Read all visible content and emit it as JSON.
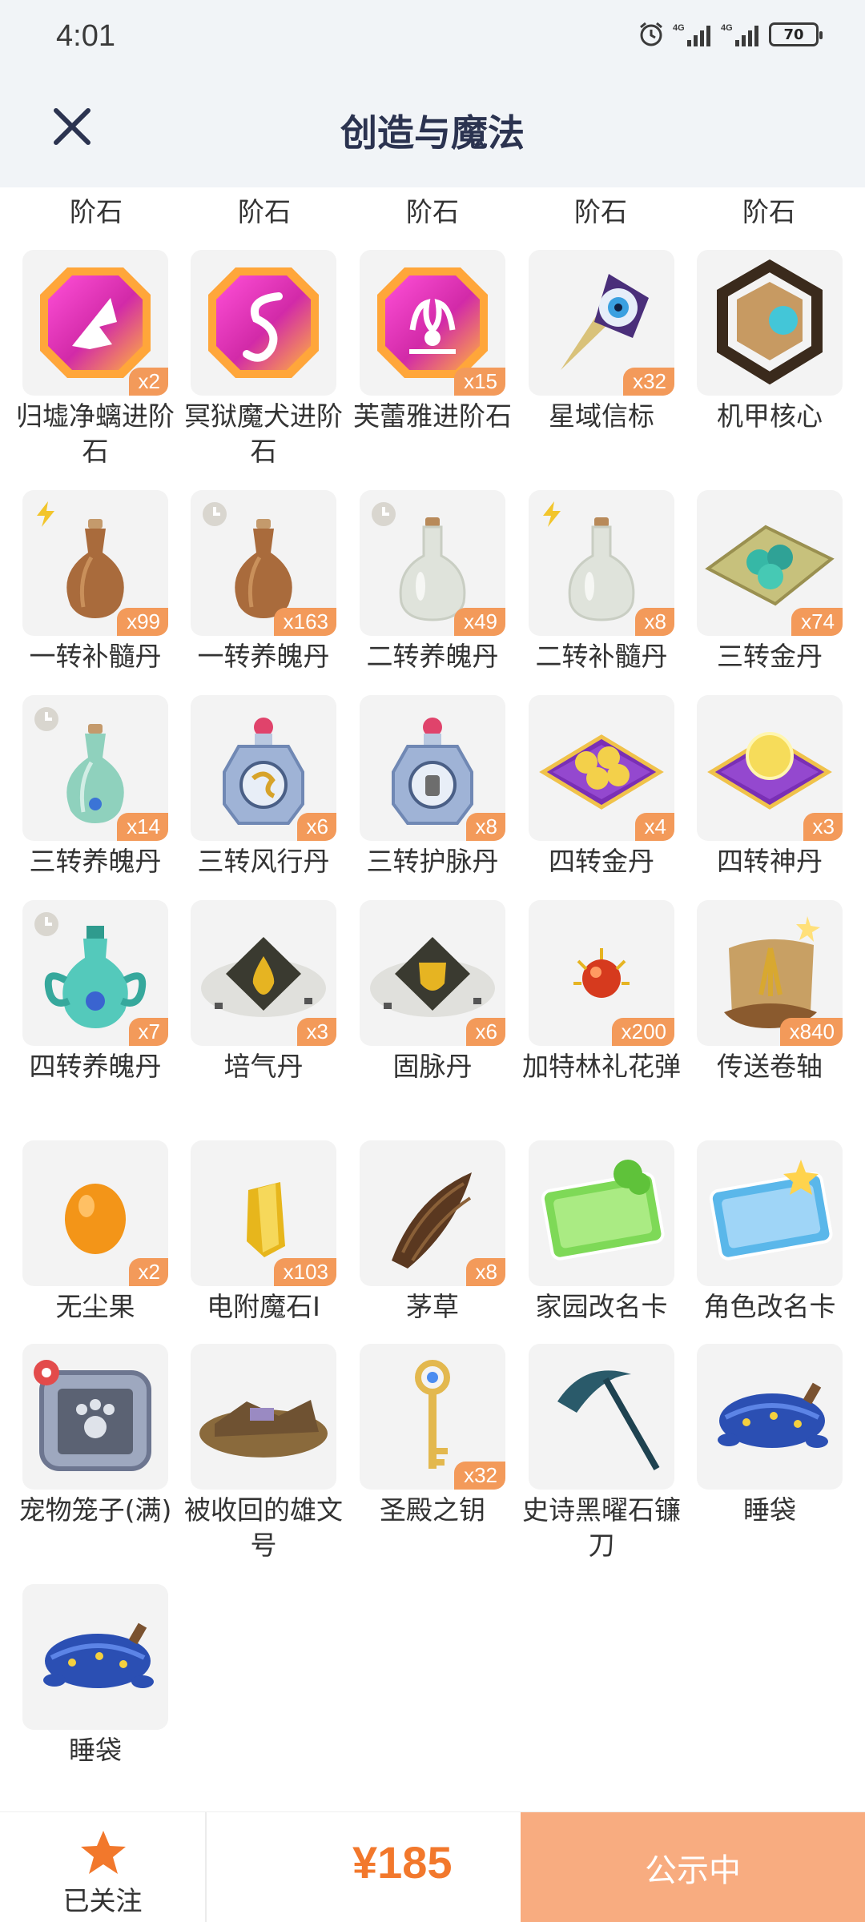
{
  "status_bar": {
    "time": "4:01",
    "network_1": "4G",
    "network_2": "4G",
    "battery": "70"
  },
  "header": {
    "title": "创造与魔法"
  },
  "top_labels": [
    "阶石",
    "阶石",
    "阶石",
    "阶石",
    "阶石"
  ],
  "items": [
    {
      "name": "归墟净螭进阶石",
      "count": "x2",
      "icon": "pink-gem-wing-icon"
    },
    {
      "name": "冥狱魔犬进阶石",
      "count": "",
      "icon": "pink-gem-s-icon"
    },
    {
      "name": "芙蕾雅进阶石",
      "count": "x15",
      "icon": "pink-gem-flame-icon"
    },
    {
      "name": "星域信标",
      "count": "x32",
      "icon": "star-beacon-icon"
    },
    {
      "name": "机甲核心",
      "count": "",
      "icon": "mech-core-icon"
    },
    {
      "name": "一转补髓丹",
      "count": "x99",
      "icon": "brown-vase-icon",
      "badge": "lightning-icon"
    },
    {
      "name": "一转养魄丹",
      "count": "x163",
      "icon": "brown-vase-icon",
      "badge": "clock-icon"
    },
    {
      "name": "二转养魄丹",
      "count": "x49",
      "icon": "white-bottle-icon",
      "badge": "clock-icon"
    },
    {
      "name": "二转补髓丹",
      "count": "x8",
      "icon": "white-bottle-icon",
      "badge": "lightning-icon"
    },
    {
      "name": "三转金丹",
      "count": "x74",
      "icon": "pill-cloth-icon"
    },
    {
      "name": "三转养魄丹",
      "count": "x14",
      "icon": "teal-vase-icon",
      "badge": "clock-icon"
    },
    {
      "name": "三转风行丹",
      "count": "x6",
      "icon": "wind-flask-icon"
    },
    {
      "name": "三转护脉丹",
      "count": "x8",
      "icon": "shield-flask-icon"
    },
    {
      "name": "四转金丹",
      "count": "x4",
      "icon": "purple-cushion-pills-icon"
    },
    {
      "name": "四转神丹",
      "count": "x3",
      "icon": "purple-cushion-orb-icon"
    },
    {
      "name": "四转养魄丹",
      "count": "x7",
      "icon": "ornate-teal-vase-icon",
      "badge": "clock-icon"
    },
    {
      "name": "培气丹",
      "count": "x3",
      "icon": "drop-dust-icon"
    },
    {
      "name": "固脉丹",
      "count": "x6",
      "icon": "shield-dust-icon"
    },
    {
      "name": "加特林礼花弹",
      "count": "x200",
      "icon": "firework-icon"
    },
    {
      "name": "传送卷轴",
      "count": "x840",
      "icon": "scroll-icon"
    },
    {
      "name": "无尘果",
      "count": "x2",
      "icon": "orange-fruit-icon"
    },
    {
      "name": "电附魔石I",
      "count": "x103",
      "icon": "yellow-crystal-icon"
    },
    {
      "name": "茅草",
      "count": "x8",
      "icon": "thatch-icon"
    },
    {
      "name": "家园改名卡",
      "count": "",
      "icon": "home-rename-card-icon"
    },
    {
      "name": "角色改名卡",
      "count": "",
      "icon": "role-rename-card-icon"
    },
    {
      "name": "宠物笼子(满)",
      "count": "",
      "icon": "pet-cage-icon"
    },
    {
      "name": "被收回的雄文号",
      "count": "",
      "icon": "wreck-ship-icon"
    },
    {
      "name": "圣殿之钥",
      "count": "x32",
      "icon": "temple-key-icon"
    },
    {
      "name": "史诗黑曜石镰刀",
      "count": "",
      "icon": "scythe-icon"
    },
    {
      "name": "睡袋",
      "count": "",
      "icon": "sleeping-bag-icon"
    },
    {
      "name": "睡袋",
      "count": "",
      "icon": "sleeping-bag-icon"
    }
  ],
  "bottom_bar": {
    "follow_label": "已关注",
    "price": "¥185",
    "status_button": "公示中"
  },
  "colors": {
    "accent": "#f39a5a",
    "price": "#f2782c",
    "status_button": "#f8ac80",
    "header_bg": "#f1f4f7"
  }
}
